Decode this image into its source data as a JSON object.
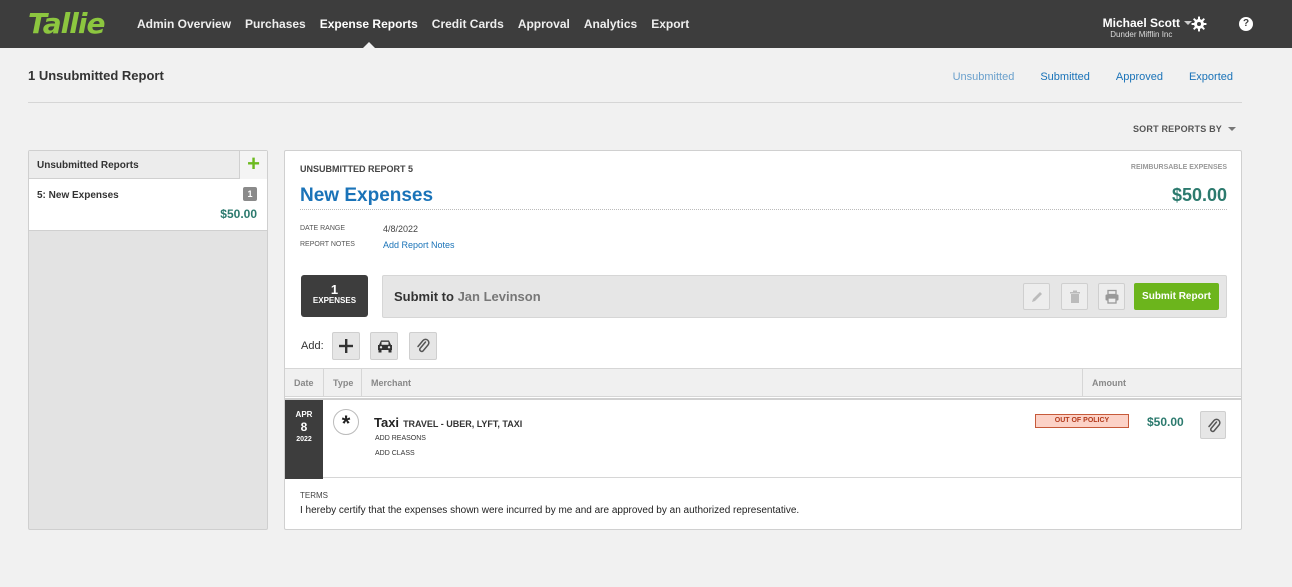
{
  "brand": {
    "logo": "Tallie",
    "accent": "#8cc63f"
  },
  "nav": {
    "items": [
      {
        "label": "Admin Overview"
      },
      {
        "label": "Purchases"
      },
      {
        "label": "Expense Reports",
        "active": true
      },
      {
        "label": "Credit Cards"
      },
      {
        "label": "Approval"
      },
      {
        "label": "Analytics"
      },
      {
        "label": "Export"
      }
    ],
    "user_name": "Michael Scott",
    "user_org": "Dunder Mifflin Inc",
    "help_label": "?"
  },
  "page": {
    "title": "1 Unsubmitted Report",
    "tabs": [
      "Unsubmitted",
      "Submitted",
      "Approved",
      "Exported"
    ],
    "sort_label": "SORT REPORTS BY"
  },
  "sidebar": {
    "header": "Unsubmitted Reports",
    "add_label": "+",
    "items": [
      {
        "name": "5: New Expenses",
        "count": "1",
        "amount": "$50.00"
      }
    ]
  },
  "report": {
    "label": "UNSUBMITTED REPORT 5",
    "reimbursable_label": "REIMBURSABLE EXPENSES",
    "title": "New Expenses",
    "amount": "$50.00",
    "date_range_label": "DATE RANGE",
    "date_range": "4/8/2022",
    "notes_label": "REPORT NOTES",
    "notes_link": "Add Report Notes",
    "expense_count": "1",
    "expense_count_label": "EXPENSES",
    "submit_prefix": "Submit to",
    "submit_to": "Jan Levinson",
    "submit_button": "Submit Report",
    "add_label": "Add:"
  },
  "table": {
    "columns": [
      "Date",
      "Type",
      "Merchant",
      "Amount"
    ],
    "rows": [
      {
        "month": "APR",
        "day": "8",
        "year": "2022",
        "type_icon": "*",
        "merchant": "Taxi",
        "category": "TRAVEL - UBER, LYFT, TAXI",
        "reasons_link": "ADD REASONS",
        "class_link": "ADD CLASS",
        "policy_badge": "OUT OF POLICY",
        "amount": "$50.00"
      }
    ]
  },
  "terms": {
    "label": "TERMS",
    "text": "I hereby certify that the expenses shown were incurred by me and are approved by an authorized representative."
  }
}
